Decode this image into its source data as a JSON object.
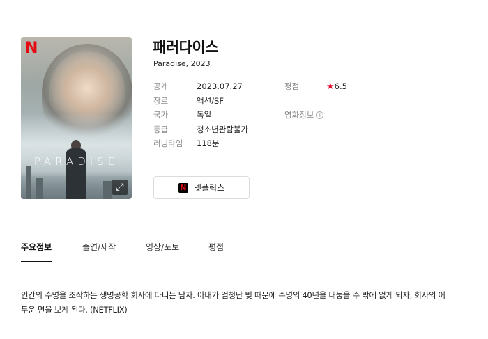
{
  "movie": {
    "title": "패러다이스",
    "subtitle": "Paradise, 2023",
    "poster": {
      "brand_letter": "N",
      "title_text": "PARADISE",
      "expand_icon": "expand-icon"
    }
  },
  "details": {
    "left": [
      {
        "label": "공개",
        "value": "2023.07.27"
      },
      {
        "label": "장르",
        "value": "액션/SF"
      },
      {
        "label": "국가",
        "value": "독일"
      },
      {
        "label": "등급",
        "value": "청소년관람불가"
      },
      {
        "label": "러닝타임",
        "value": "118분"
      }
    ],
    "rating_label": "평점",
    "rating_value": "6.5",
    "rating_star": "★",
    "movie_info_label": "영화정보",
    "info_icon": "!"
  },
  "watch_button": {
    "label": "넷플릭스",
    "logo_letter": "N",
    "brand_color": "#e50914"
  },
  "tabs": [
    {
      "label": "주요정보",
      "active": true
    },
    {
      "label": "출연/제작",
      "active": false
    },
    {
      "label": "영상/포토",
      "active": false
    },
    {
      "label": "평점",
      "active": false
    }
  ],
  "description": "인간의 수명을 조작하는 생명공학 회사에 다니는 남자. 아내가 엄청난 빚 때문에 수명의 40년을 내놓을 수 밖에 없게 되자, 회사의 어두운 면을 보게 된다. (NETFLIX)"
}
